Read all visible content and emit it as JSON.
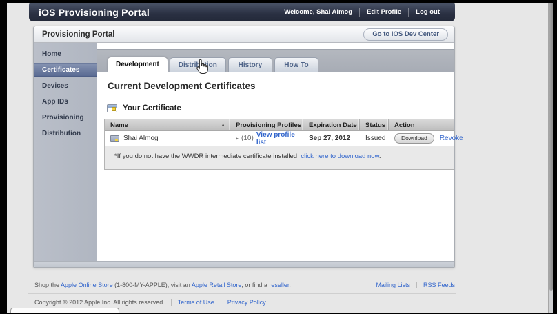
{
  "header": {
    "title": "iOS Provisioning Portal",
    "welcome": "Welcome, Shai Almog",
    "edit_profile": "Edit Profile",
    "log_out": "Log out"
  },
  "portal": {
    "title": "Provisioning Portal",
    "dev_center_button": "Go to iOS Dev Center"
  },
  "sidebar": {
    "items": [
      {
        "label": "Home",
        "selected": false
      },
      {
        "label": "Certificates",
        "selected": true
      },
      {
        "label": "Devices",
        "selected": false
      },
      {
        "label": "App IDs",
        "selected": false
      },
      {
        "label": "Provisioning",
        "selected": false
      },
      {
        "label": "Distribution",
        "selected": false
      }
    ]
  },
  "tabs": [
    {
      "label": "Development",
      "active": true
    },
    {
      "label": "Distribution",
      "active": false
    },
    {
      "label": "History",
      "active": false
    },
    {
      "label": "How To",
      "active": false
    }
  ],
  "content": {
    "heading": "Current Development Certificates",
    "section_title": "Your Certificate",
    "table": {
      "columns": [
        "Name",
        "Provisioning Profiles",
        "Expiration Date",
        "Status",
        "Action"
      ],
      "sort_arrow": "▲",
      "row": {
        "name": "Shai Almog",
        "disclosure": "▸",
        "profiles_count": "(10)",
        "profiles_link": "View profile list",
        "expiration": "Sep 27, 2012",
        "status": "Issued",
        "download_label": "Download",
        "revoke_label": "Revoke"
      }
    },
    "note": {
      "prefix": "*If you do not have the WWDR intermediate certificate installed, ",
      "link": "click here to download now",
      "suffix": "."
    }
  },
  "footer": {
    "shop_prefix": "Shop the ",
    "link_online_store": "Apple Online Store",
    "shop_mid1": " (1-800-MY-APPLE), visit an ",
    "link_retail_store": "Apple Retail Store",
    "shop_mid2": ", or find a ",
    "link_reseller": "reseller",
    "shop_suffix": ".",
    "mailing_lists": "Mailing Lists",
    "rss_feeds": "RSS Feeds",
    "copyright": "Copyright © 2012 Apple Inc. All rights reserved.",
    "terms": "Terms of Use",
    "privacy": "Privacy Policy"
  },
  "colors": {
    "navbar_bg": "#2a3042",
    "link_blue": "#3366cc",
    "sidebar_selected": "#5a6b93"
  }
}
